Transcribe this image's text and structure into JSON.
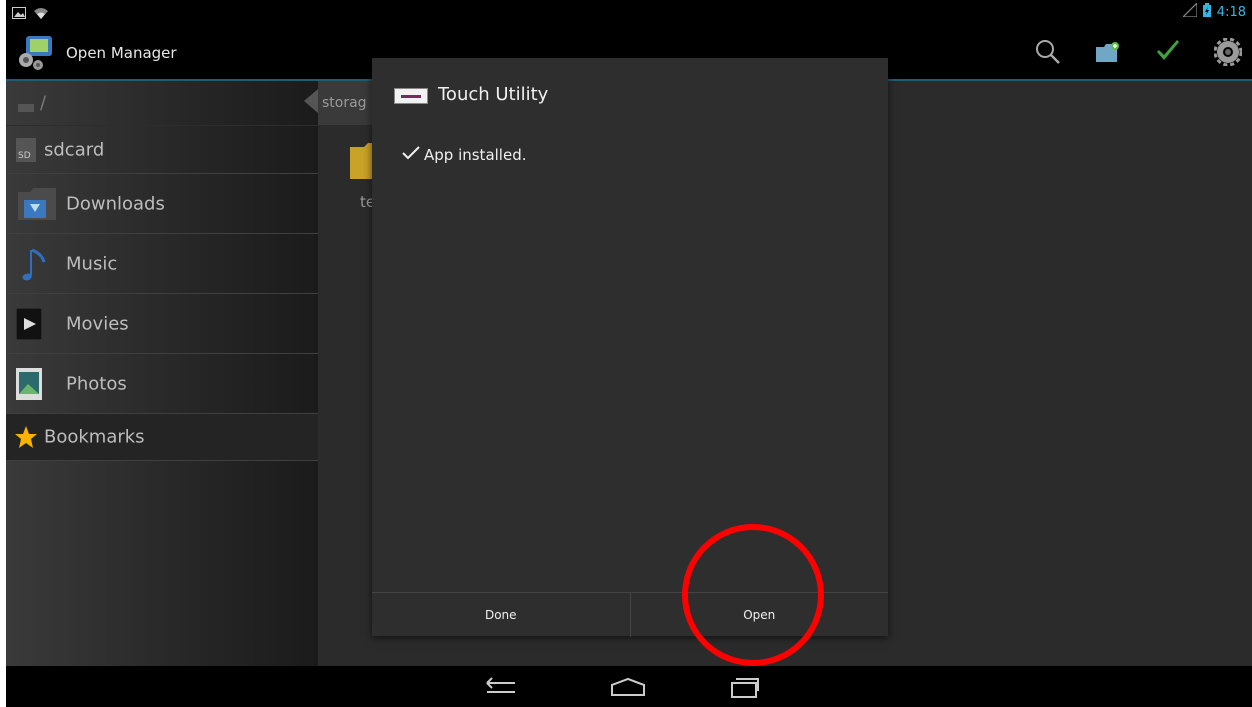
{
  "status_bar": {
    "time": "4:18",
    "icons": [
      "gallery-notification-icon",
      "wifi-icon",
      "signal-icon",
      "battery-icon"
    ]
  },
  "action_bar": {
    "title": "Open Manager",
    "actions": [
      "search-icon",
      "new-folder-icon",
      "multi-select-icon",
      "settings-icon"
    ]
  },
  "sidebar": {
    "root_path": "/",
    "items": [
      {
        "label": "sdcard",
        "icon": "sdcard-icon"
      },
      {
        "label": "Downloads",
        "icon": "downloads-folder-icon"
      },
      {
        "label": "Music",
        "icon": "music-note-icon"
      },
      {
        "label": "Movies",
        "icon": "movie-play-icon"
      },
      {
        "label": "Photos",
        "icon": "photo-icon"
      },
      {
        "label": "Bookmarks",
        "icon": "star-icon"
      }
    ]
  },
  "main": {
    "path_chip": "storag",
    "folder_label": "te"
  },
  "dialog": {
    "app_name": "Touch Utility",
    "message": "App installed.",
    "buttons": {
      "done": "Done",
      "open": "Open"
    }
  },
  "colors": {
    "accent": "#33b5e5",
    "annotation": "#ff0000",
    "dialog_bg": "#2e2e2e"
  }
}
